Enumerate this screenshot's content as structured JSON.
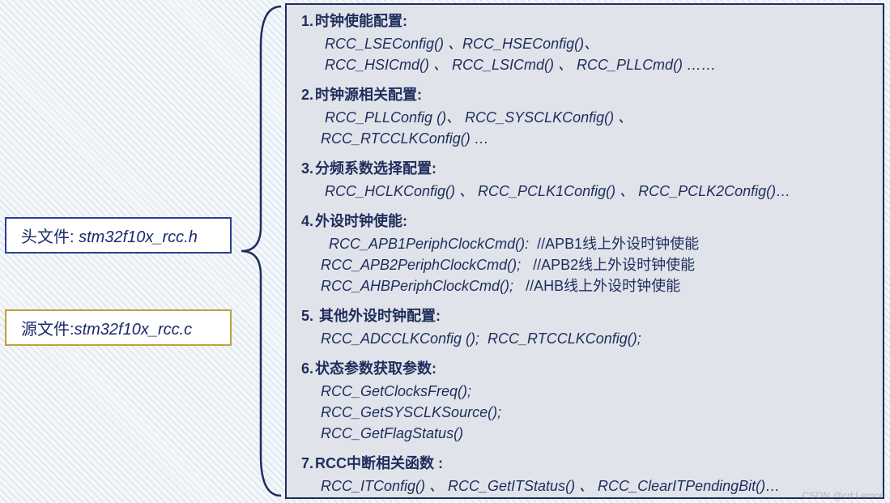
{
  "left": {
    "header_label_prefix": "头文件:",
    "header_file": " stm32f10x_rcc.h",
    "source_label_prefix": "源文件:",
    "source_file": "stm32f10x_rcc.c"
  },
  "panel": {
    "sections": [
      {
        "num": "1.",
        "title": "时钟使能配置:",
        "lines": [
          " RCC_LSEConfig() 、RCC_HSEConfig()、",
          " RCC_HSICmd() 、 RCC_LSICmd() 、 RCC_PLLCmd() ……"
        ]
      },
      {
        "num": "2.",
        "title": "时钟源相关配置:",
        "lines": [
          " RCC_PLLConfig ()、 RCC_SYSCLKConfig() 、",
          "RCC_RTCCLKConfig() …"
        ]
      },
      {
        "num": "3.",
        "title": "分频系数选择配置:",
        "lines": [
          " RCC_HCLKConfig() 、 RCC_PCLK1Config() 、 RCC_PCLK2Config()…"
        ]
      },
      {
        "num": "4.",
        "title": "外设时钟使能:",
        "lines_with_comments": [
          {
            "fn": "  RCC_APB1PeriphClockCmd():",
            "comment": "  //APB1线上外设时钟使能"
          },
          {
            "fn": "RCC_APB2PeriphClockCmd();",
            "comment": "   //APB2线上外设时钟使能"
          },
          {
            "fn": "RCC_AHBPeriphClockCmd();",
            "comment": "   //AHB线上外设时钟使能"
          }
        ]
      },
      {
        "num": "5.",
        "title": " 其他外设时钟配置:",
        "lines": [
          "RCC_ADCCLKConfig ();  RCC_RTCCLKConfig();"
        ]
      },
      {
        "num": "6.",
        "title": "状态参数获取参数:",
        "lines": [
          "RCC_GetClocksFreq();",
          "RCC_GetSYSCLKSource();",
          "RCC_GetFlagStatus()"
        ]
      },
      {
        "num": "7.",
        "title_bold_prefix": "RCC",
        "title_rest": "中断相关函数 :",
        "lines": [
          "RCC_ITConfig() 、 RCC_GetITStatus() 、 RCC_ClearITPendingBit()…"
        ]
      }
    ]
  },
  "watermark": "CSDN @cd:Lemon"
}
